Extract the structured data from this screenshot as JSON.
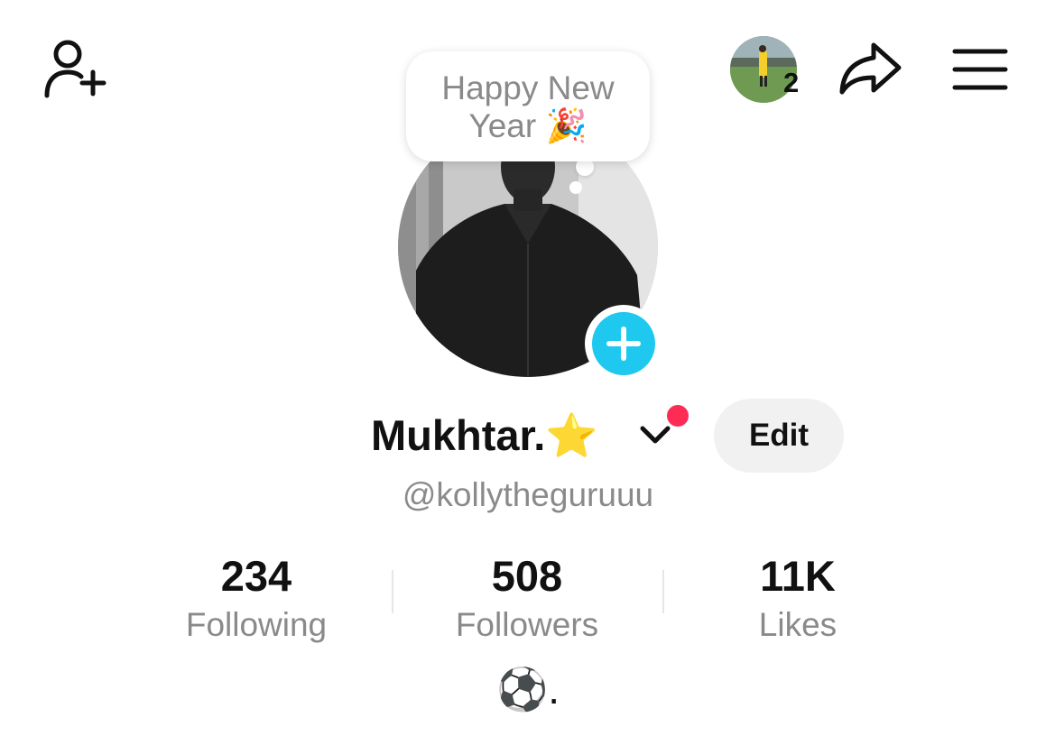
{
  "header": {
    "add_friend_icon": "person-plus-icon",
    "story_count": "2",
    "share_icon": "share-arrow-icon",
    "menu_icon": "hamburger-menu-icon"
  },
  "profile": {
    "note_text": "Happy New Year 🎉",
    "name": "Mukhtar.⭐️",
    "handle": "@kollytheguruuu",
    "edit_label": "Edit",
    "bio": "⚽️."
  },
  "stats": [
    {
      "value": "234",
      "label": "Following"
    },
    {
      "value": "508",
      "label": "Followers"
    },
    {
      "value": "11K",
      "label": "Likes"
    }
  ],
  "colors": {
    "accent_blue": "#1ec8ef",
    "notification_red": "#fe2c55",
    "edit_bg": "#f1f1f2",
    "muted_text": "#8a8a8a"
  }
}
